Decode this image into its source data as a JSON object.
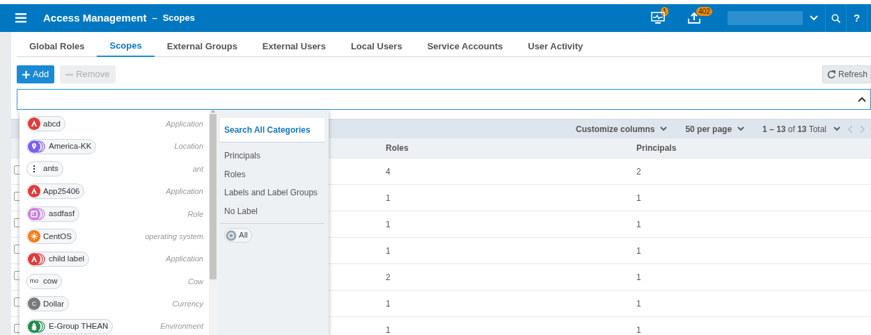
{
  "header": {
    "title": "Access Management",
    "separator": "–",
    "subtitle": "Scopes",
    "alerts_badge": "1",
    "uploads_badge": "402",
    "help": "?"
  },
  "tabs": [
    {
      "label": "Global Roles",
      "selected": false
    },
    {
      "label": "Scopes",
      "selected": true
    },
    {
      "label": "External Groups",
      "selected": false
    },
    {
      "label": "External Users",
      "selected": false
    },
    {
      "label": "Local Users",
      "selected": false
    },
    {
      "label": "Service Accounts",
      "selected": false
    },
    {
      "label": "User Activity",
      "selected": false
    }
  ],
  "toolbar": {
    "add": {
      "label": "Add",
      "disabled": false
    },
    "remove": {
      "label": "Remove",
      "disabled": true
    },
    "refresh": "Refresh"
  },
  "table": {
    "customize": "Customize columns",
    "per_page": "50 per page",
    "pager": "**1 – 13** of **13** Total",
    "columns": [
      "Roles",
      "Principals"
    ],
    "rows": [
      {
        "checked": false,
        "roles": "4",
        "principals": "2"
      },
      {
        "checked": false,
        "roles": "1",
        "principals": "1"
      },
      {
        "checked": false,
        "roles": "1",
        "principals": "1"
      },
      {
        "checked": false,
        "roles": "1",
        "principals": "1"
      },
      {
        "checked": false,
        "roles": "2",
        "principals": "1"
      },
      {
        "checked": false,
        "roles": "1",
        "principals": "1"
      },
      {
        "checked": false,
        "roles": "1",
        "principals": "1"
      }
    ]
  },
  "dropdown": {
    "labels": [
      {
        "name": "abcd",
        "category": "Application",
        "kind": "letter-a",
        "color": "#e03b3b",
        "group": false
      },
      {
        "name": "America-KK",
        "category": "Location",
        "kind": "pin",
        "color": "#7b5ff0",
        "group": true
      },
      {
        "name": "ants",
        "category": "ant",
        "kind": "dots",
        "color": "#ffffff",
        "group": false
      },
      {
        "name": "App25406",
        "category": "Application",
        "kind": "letter-a",
        "color": "#e03b3b",
        "group": false
      },
      {
        "name": "asdfasf",
        "category": "Role",
        "kind": "square",
        "color": "#c77fdc",
        "group": true
      },
      {
        "name": "CentOS",
        "category": "operating system",
        "kind": "sun",
        "color": "#f47a12",
        "group": false
      },
      {
        "name": "child label",
        "category": "Application",
        "kind": "letter-a",
        "color": "#e03b3b",
        "group": true
      },
      {
        "name": "cow",
        "category": "Cow",
        "kind": "text",
        "icon_text": "mo",
        "color": "#ffffff",
        "group": false
      },
      {
        "name": "Dollar",
        "category": "Currency",
        "kind": "text",
        "icon_text": "C",
        "color": "#7a7a7a",
        "group": false
      },
      {
        "name": "E-Group THEAN",
        "category": "Environment",
        "kind": "tree",
        "color": "#1f8a4c",
        "group": true
      }
    ],
    "search_all": "Search All Categories",
    "categories": [
      "Principals",
      "Roles",
      "Labels and Label Groups",
      "No Label"
    ],
    "all_chip": "All"
  }
}
